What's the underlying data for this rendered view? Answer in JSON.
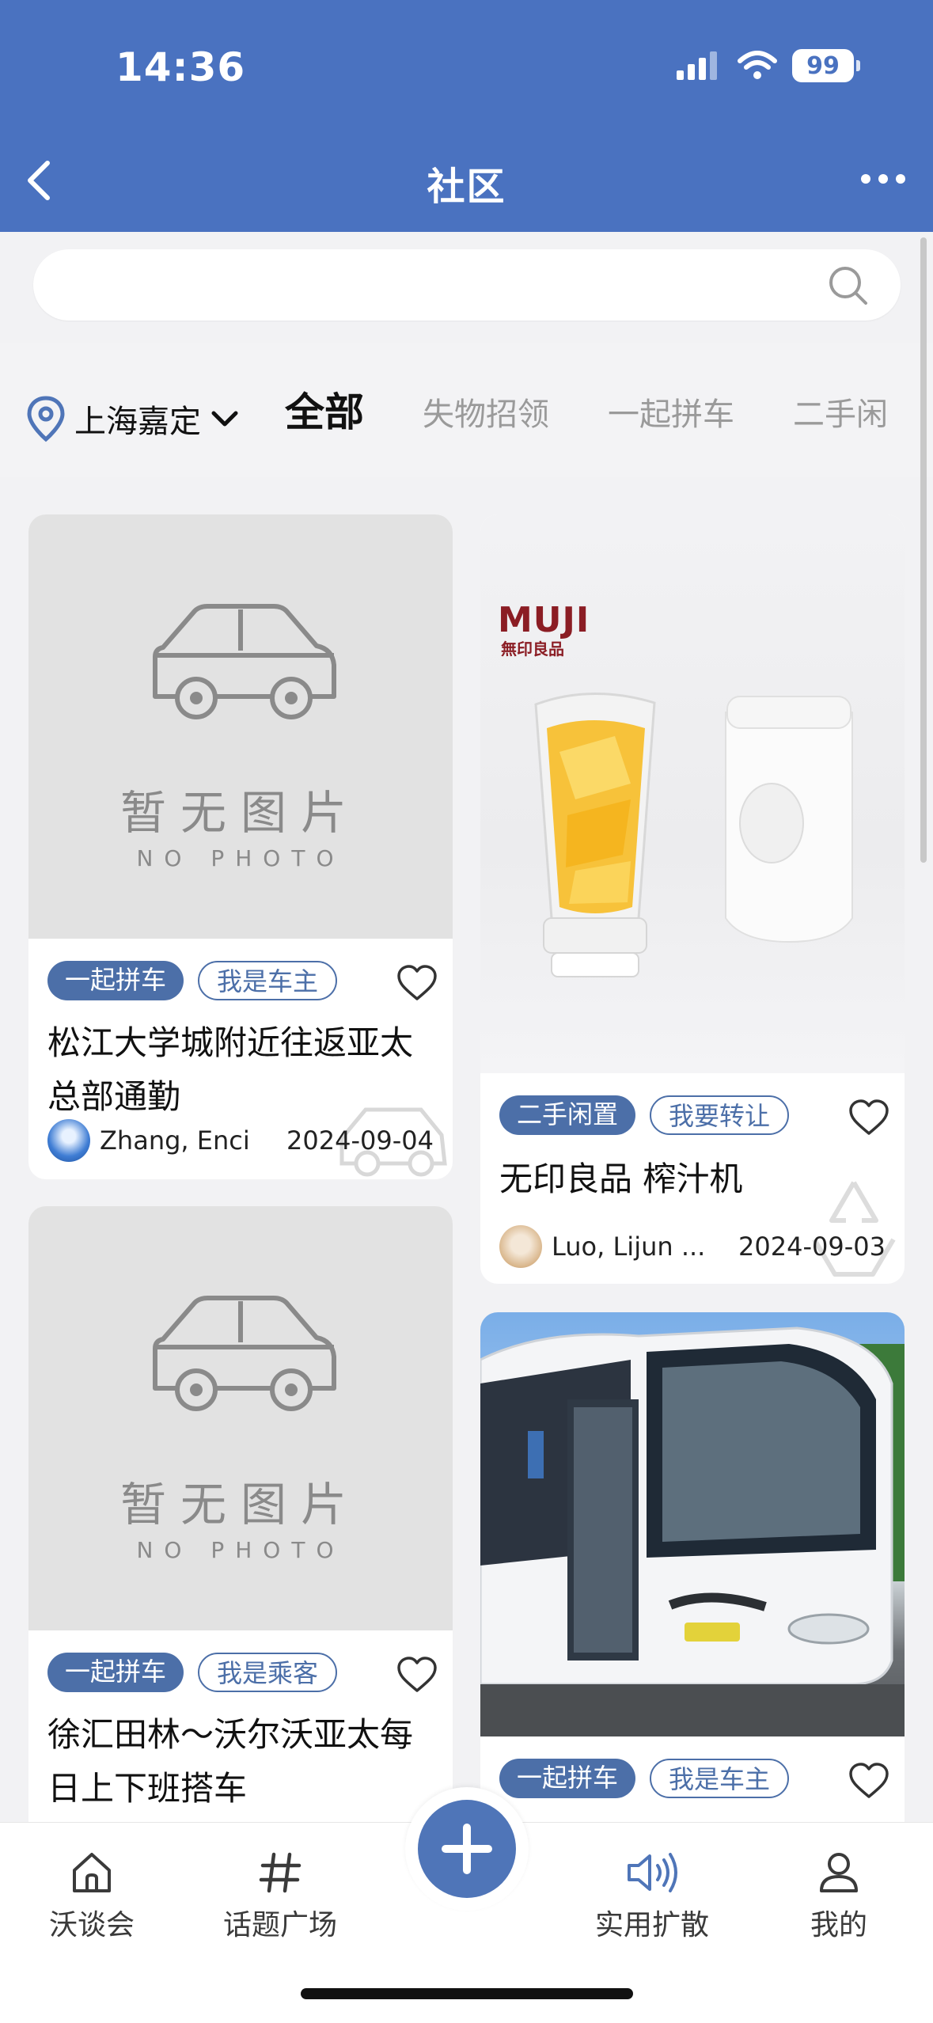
{
  "status_bar": {
    "time": "14:36",
    "battery": "99"
  },
  "header": {
    "title": "社区"
  },
  "search": {
    "placeholder": ""
  },
  "filter": {
    "location": "上海嘉定",
    "tabs": [
      "全部",
      "失物招领",
      "一起拼车",
      "二手闲"
    ]
  },
  "no_photo": {
    "cn": "暂无图片",
    "en": "NO PHOTO"
  },
  "posts": [
    {
      "tags": [
        "一起拼车",
        "我是车主"
      ],
      "title": "松江大学城附近往返亚太总部通勤",
      "author": "Zhang, Enci",
      "date": "2024-09-04"
    },
    {
      "tags": [
        "二手闲置",
        "我要转让"
      ],
      "title": "无印良品 榨汁机",
      "author": "Luo, Lijun ...",
      "date": "2024-09-03",
      "image_brand": "MUJI",
      "image_brand_sub": "無印良品"
    },
    {
      "tags": [
        "一起拼车",
        "我是乘客"
      ],
      "title": "徐汇田林～沃尔沃亚太每日上下班搭车"
    },
    {
      "tags": [
        "一起拼车",
        "我是车主"
      ]
    }
  ],
  "bottom_nav": {
    "items": [
      "沃谈会",
      "话题广场",
      "实用扩散",
      "我的"
    ]
  },
  "colors": {
    "primary": "#4a72c0",
    "tag": "#4c6fa8"
  }
}
